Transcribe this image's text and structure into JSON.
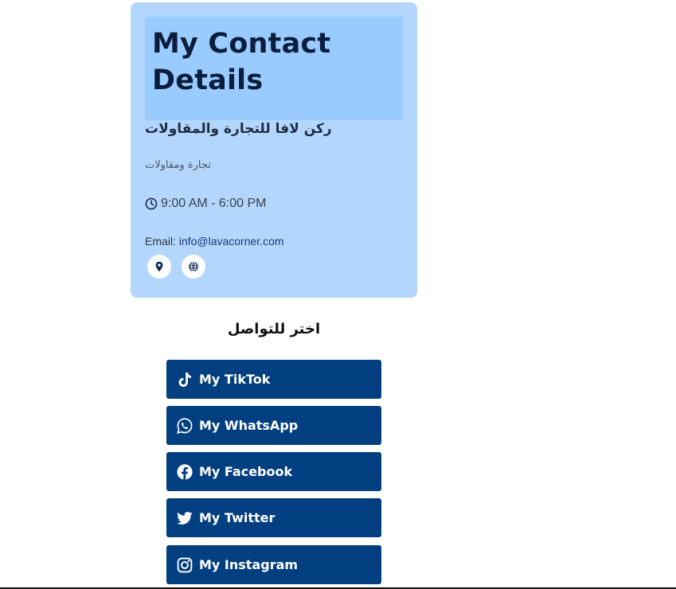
{
  "card": {
    "title": "My Contact Details",
    "company_name": "ركن لافا للتجارة والمقاولات",
    "tagline": "تجارة ومقاولات",
    "hours": "9:00 AM - 6:00 PM",
    "email_label": "Email: ",
    "email_value": "info@lavacorner.com",
    "icons": [
      "location-pin-icon",
      "globe-icon",
      "clock-icon"
    ]
  },
  "links": {
    "heading": "اختر للتواصل",
    "buttons": [
      {
        "label": "My TikTok",
        "icon": "tiktok-icon"
      },
      {
        "label": "My WhatsApp",
        "icon": "whatsapp-icon"
      },
      {
        "label": "My Facebook",
        "icon": "facebook-icon"
      },
      {
        "label": "My Twitter",
        "icon": "twitter-icon"
      },
      {
        "label": "My Instagram",
        "icon": "instagram-icon"
      }
    ]
  },
  "colors": {
    "card_bg": "#b3d6fc",
    "title_box_bg": "#99cbfe",
    "button_bg": "#023f80",
    "title_text": "#0b1d3d"
  }
}
